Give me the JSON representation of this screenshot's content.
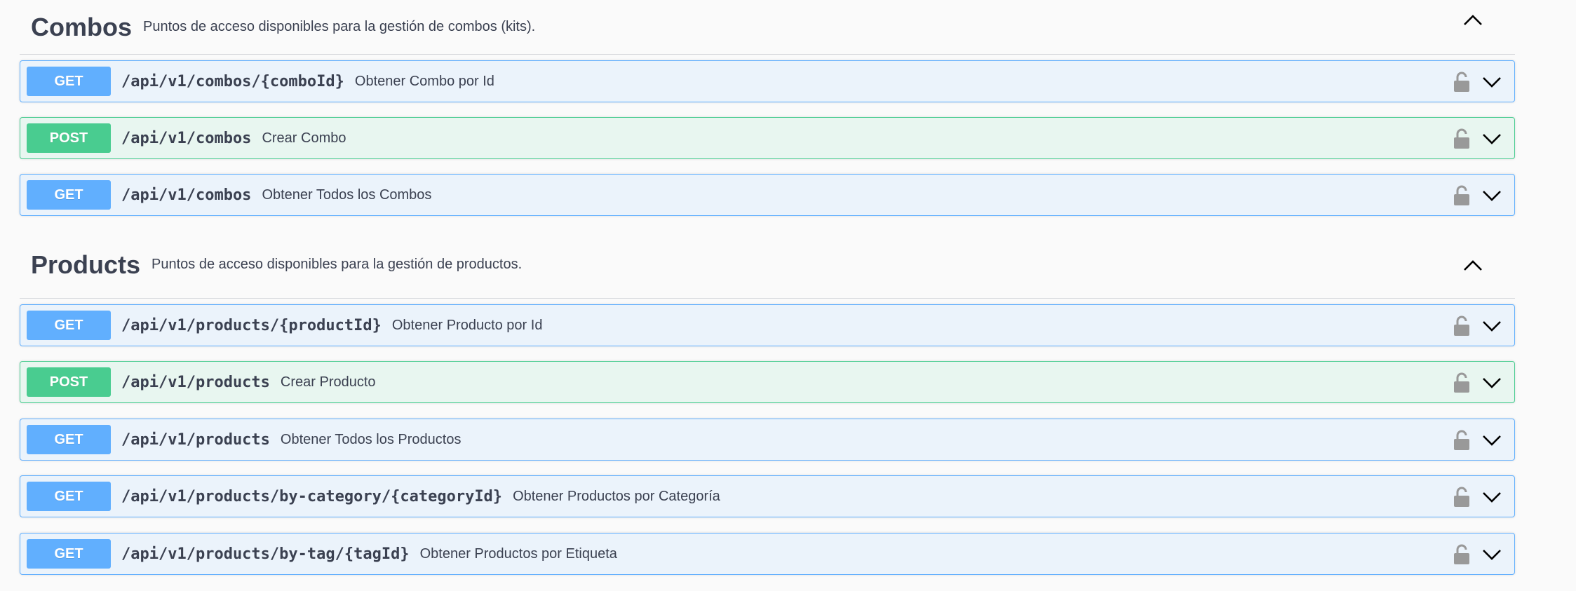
{
  "sections": [
    {
      "title": "Combos",
      "description": "Puntos de acceso disponibles para la gestión de combos (kits).",
      "operations": [
        {
          "method": "GET",
          "path": "/api/v1/combos/{comboId}",
          "summary": "Obtener Combo por Id"
        },
        {
          "method": "POST",
          "path": "/api/v1/combos",
          "summary": "Crear Combo"
        },
        {
          "method": "GET",
          "path": "/api/v1/combos",
          "summary": "Obtener Todos los Combos"
        }
      ]
    },
    {
      "title": "Products",
      "description": "Puntos de acceso disponibles para la gestión de productos.",
      "operations": [
        {
          "method": "GET",
          "path": "/api/v1/products/{productId}",
          "summary": "Obtener Producto por Id"
        },
        {
          "method": "POST",
          "path": "/api/v1/products",
          "summary": "Crear Producto"
        },
        {
          "method": "GET",
          "path": "/api/v1/products",
          "summary": "Obtener Todos los Productos"
        },
        {
          "method": "GET",
          "path": "/api/v1/products/by-category/{categoryId}",
          "summary": "Obtener Productos por Categoría"
        },
        {
          "method": "GET",
          "path": "/api/v1/products/by-tag/{tagId}",
          "summary": "Obtener Productos por Etiqueta"
        }
      ]
    }
  ],
  "colors": {
    "get": "#61affe",
    "post": "#49cc90",
    "text": "#3b4151"
  },
  "icons": {
    "lock": "lock-icon",
    "expand": "chevron-down-icon",
    "collapse": "chevron-up-icon"
  }
}
